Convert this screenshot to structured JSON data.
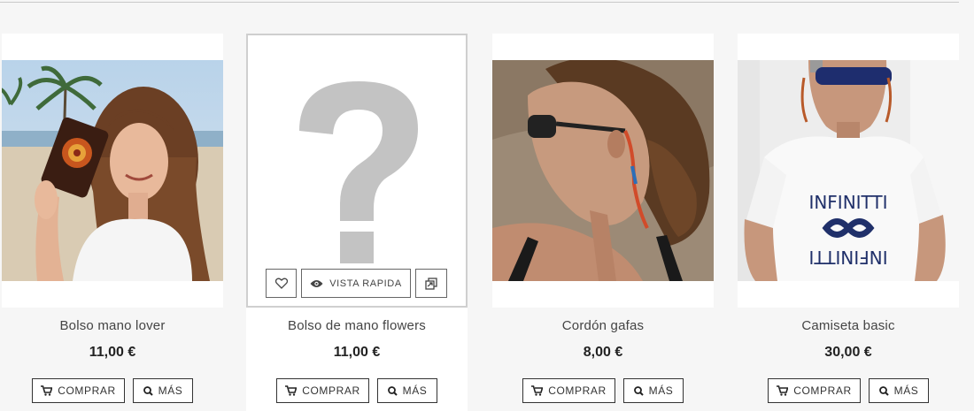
{
  "products": [
    {
      "title": "Bolso mano lover",
      "price": "11,00 €",
      "buy_label": "COMPRAR",
      "more_label": "MÁS"
    },
    {
      "title": "Bolso de mano flowers",
      "price": "11,00 €",
      "buy_label": "COMPRAR",
      "more_label": "MÁS"
    },
    {
      "title": "Cordón gafas",
      "price": "8,00 €",
      "buy_label": "COMPRAR",
      "more_label": "MÁS"
    },
    {
      "title": "Camiseta basic",
      "price": "30,00 €",
      "buy_label": "COMPRAR",
      "more_label": "MÁS"
    }
  ],
  "hover_overlay": {
    "quick_view_label": "VISTA RAPIDA"
  },
  "icons": {
    "wishlist": "heart-icon",
    "quick_view": "eye-icon",
    "compare": "compare-icon",
    "cart": "cart-icon",
    "search": "search-icon"
  },
  "colors": {
    "background": "#f6f6f6",
    "card": "#ffffff",
    "border": "#333333"
  }
}
